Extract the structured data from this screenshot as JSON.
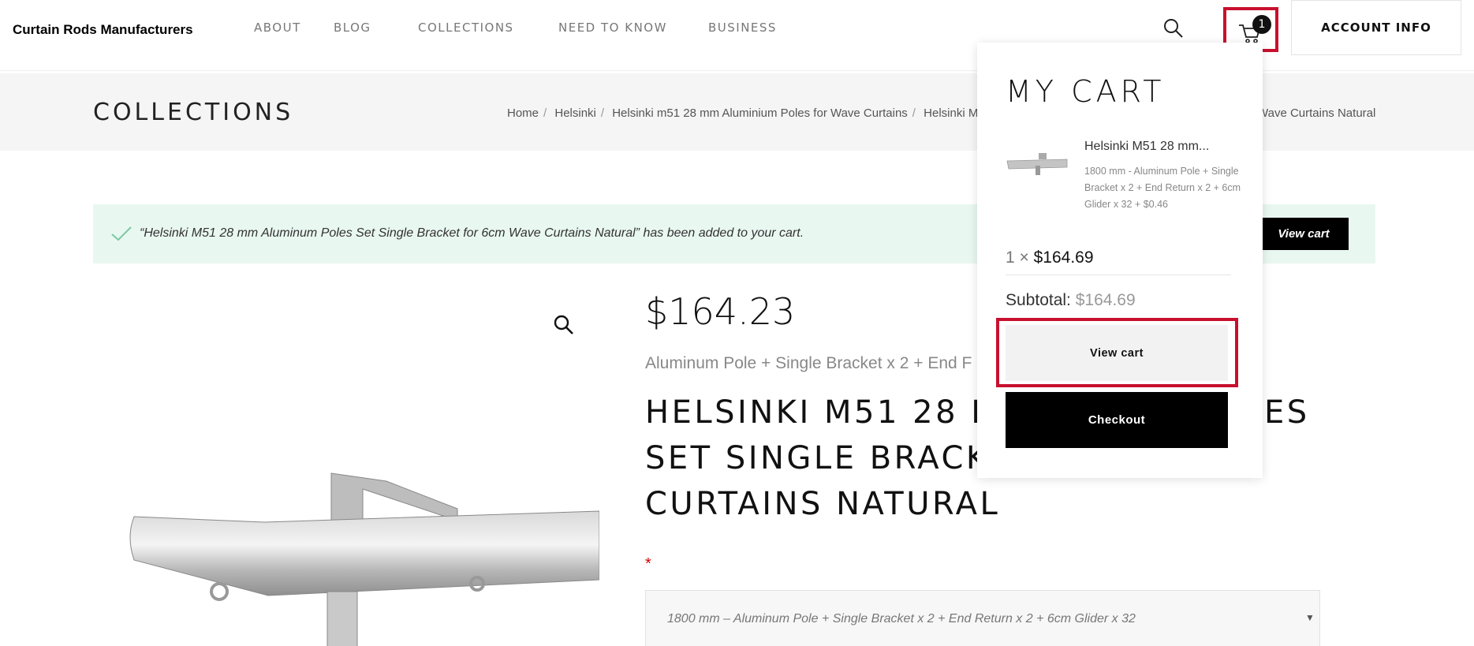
{
  "header": {
    "logo": "Curtain Rods Manufacturers",
    "nav": [
      "ABOUT",
      "BLOG",
      "COLLECTIONS",
      "NEED TO KNOW",
      "BUSINESS"
    ],
    "cart_count": "1",
    "account_label": "ACCOUNT INFO",
    "icons": {
      "search": "search-icon",
      "cart": "cart-icon"
    }
  },
  "title_bar": {
    "title": "COLLECTIONS",
    "breadcrumb": [
      "Home",
      "Helsinki",
      "Helsinki m51 28 mm Aluminium Poles for Wave Curtains",
      "Helsinki M5"
    ],
    "breadcrumb_tail": "Wave Curtains Natural"
  },
  "notice": {
    "text": "“Helsinki M51 28 mm Aluminum Poles Set Single Bracket for 6cm Wave Curtains Natural” has been added to your cart.",
    "button": "View cart"
  },
  "product": {
    "price": "$164.23",
    "variant_desc": "Aluminum Pole + Single Bracket x 2 + End F",
    "title_lines": [
      "HELSINKI M51 28 MM",
      "SET SINGLE BRACKE",
      "CURTAINS NATURAL"
    ],
    "title_right": "ES",
    "required_marker": "*",
    "variant_select": "1800 mm – Aluminum Pole + Single Bracket x 2 + End Return x 2 + 6cm Glider x 32"
  },
  "mini_cart": {
    "title": "MY CART",
    "item": {
      "name": "Helsinki M51 28 mm...",
      "meta": "1800 mm - Aluminum Pole + Single Bracket x 2 + End Return x 2 + 6cm Glider x 32 + $0.46",
      "qty": "1 ×",
      "price": "$164.69"
    },
    "subtotal_label": "Subtotal:",
    "subtotal_value": "$164.69",
    "view_cart": "View cart",
    "checkout": "Checkout"
  },
  "colors": {
    "highlight": "#c8102e",
    "notice_bg": "#e9f7f1",
    "accent": "#000000"
  }
}
